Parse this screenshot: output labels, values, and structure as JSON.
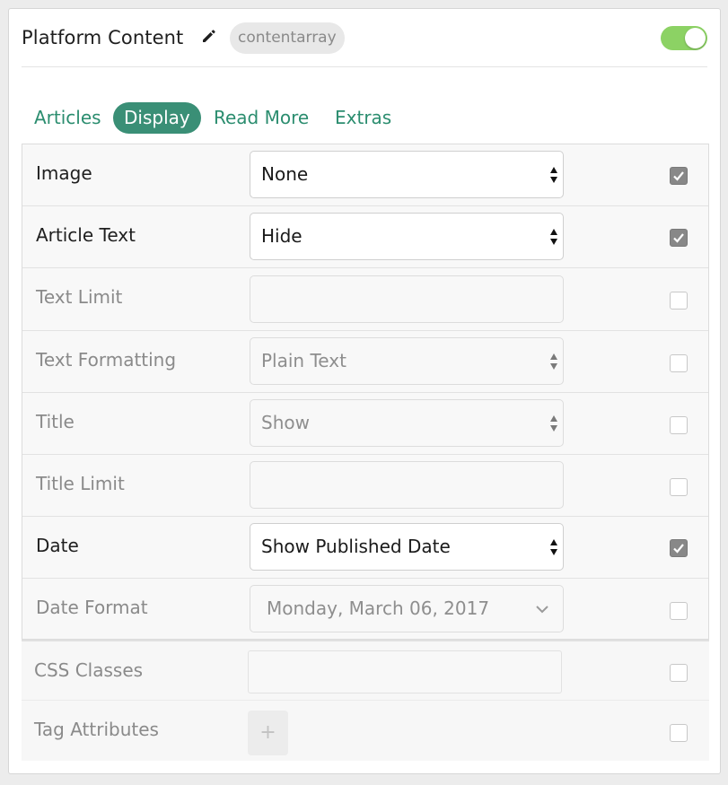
{
  "header": {
    "title": "Platform Content",
    "edit_icon": "pencil-icon",
    "badge": "contentarray",
    "toggle_on": true,
    "toggle_color": "#8cd264"
  },
  "tabs": [
    {
      "label": "Articles",
      "active": false
    },
    {
      "label": "Display",
      "active": true
    },
    {
      "label": "Read More",
      "active": false
    },
    {
      "label": "Extras",
      "active": false
    }
  ],
  "accent_color": "#3a8f76",
  "rows": [
    {
      "label": "Image",
      "type": "select",
      "value": "None",
      "checked": true
    },
    {
      "label": "Article Text",
      "type": "select",
      "value": "Hide",
      "checked": true
    },
    {
      "label": "Text Limit",
      "type": "input",
      "value": "",
      "checked": false
    },
    {
      "label": "Text Formatting",
      "type": "select",
      "value": "Plain Text",
      "checked": false
    },
    {
      "label": "Title",
      "type": "select",
      "value": "Show",
      "checked": false
    },
    {
      "label": "Title Limit",
      "type": "input",
      "value": "",
      "checked": false
    },
    {
      "label": "Date",
      "type": "select",
      "value": "Show Published Date",
      "checked": true
    },
    {
      "label": "Date Format",
      "type": "dropdown",
      "value": "Monday, March 06, 2017",
      "checked": false
    }
  ],
  "extras": {
    "css_classes_label": "CSS Classes",
    "css_classes_value": "",
    "css_checked": false,
    "tag_attributes_label": "Tag Attributes",
    "add_label": "+",
    "tag_checked": false
  }
}
